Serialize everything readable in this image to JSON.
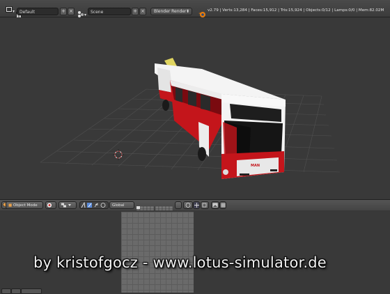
{
  "header": {
    "layout_value": "Default",
    "scene_value": "Scene",
    "render_engine": "Blender Render",
    "stats": "v2.79 | Verts:13,284 | Faces:15,912 | Tris:15,924 | Objects:0/12 | Lamps:0/0 | Mem:82.02M",
    "add_glyph": "+",
    "close_glyph": "×"
  },
  "viewport_toolbar": {
    "mode": "Object Mode",
    "orientation": "Global"
  },
  "bus": {
    "brand_text": "MAN"
  },
  "watermark": "by kristofgocz - www.lotus-simulator.de",
  "colors": {
    "viewport_bg": "#393939",
    "grid_line": "#505050",
    "bus_red": "#c4151b",
    "bus_white": "#f4f4f4"
  }
}
